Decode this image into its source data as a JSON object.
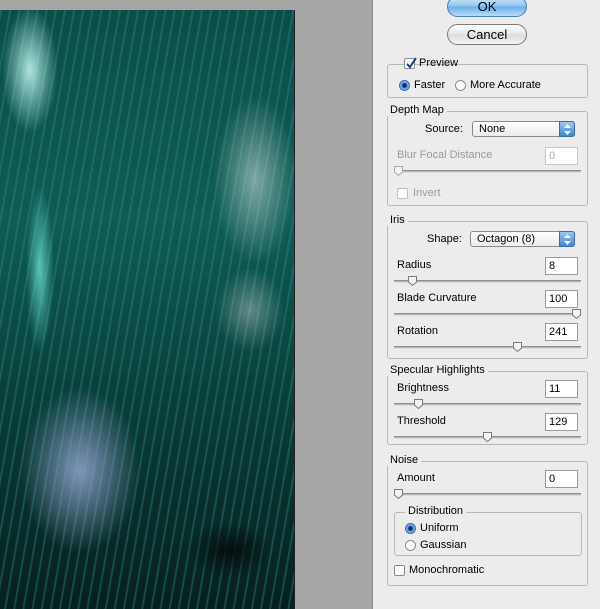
{
  "buttons": {
    "ok": "OK",
    "cancel": "Cancel"
  },
  "preview": {
    "label": "Preview",
    "checked": true,
    "mode_faster": "Faster",
    "mode_accurate": "More Accurate",
    "selected": "Faster"
  },
  "depth_map": {
    "title": "Depth Map",
    "source_label": "Source:",
    "source_value": "None",
    "blur_focal_label": "Blur Focal Distance",
    "blur_focal_value": "0",
    "blur_focal_level": 0,
    "invert_label": "Invert",
    "invert_checked": false
  },
  "iris": {
    "title": "Iris",
    "shape_label": "Shape:",
    "shape_value": "Octagon (8)",
    "radius_label": "Radius",
    "radius_value": "8",
    "radius_level": 0.08,
    "blade_label": "Blade Curvature",
    "blade_value": "100",
    "blade_level": 1.0,
    "rotation_label": "Rotation",
    "rotation_value": "241",
    "rotation_level": 0.67
  },
  "specular": {
    "title": "Specular Highlights",
    "brightness_label": "Brightness",
    "brightness_value": "11",
    "brightness_level": 0.11,
    "threshold_label": "Threshold",
    "threshold_value": "129",
    "threshold_level": 0.5
  },
  "noise": {
    "title": "Noise",
    "amount_label": "Amount",
    "amount_value": "0",
    "amount_level": 0,
    "distribution_title": "Distribution",
    "uniform_label": "Uniform",
    "gaussian_label": "Gaussian",
    "distribution_selected": "Uniform",
    "mono_label": "Monochromatic",
    "mono_checked": false
  },
  "colors": {
    "accent": "#4e8fdb",
    "panel": "#ececec",
    "canvas": "#a6a6a6"
  }
}
